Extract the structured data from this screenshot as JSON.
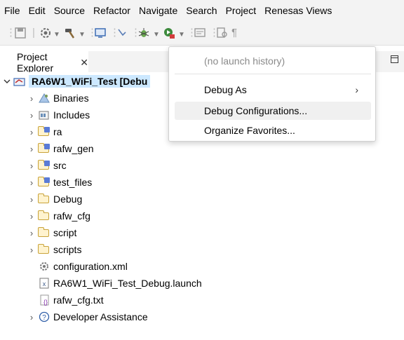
{
  "menubar": {
    "items": [
      "File",
      "Edit",
      "Source",
      "Refactor",
      "Navigate",
      "Search",
      "Project",
      "Renesas Views"
    ]
  },
  "toolbar": {
    "icons": [
      "save-icon",
      "build-icon",
      "hammer-icon",
      "terminal-icon",
      "connect-icon",
      "debug-icon",
      "run-icon",
      "open-type-icon",
      "search-icon",
      "show-whitespace-icon"
    ]
  },
  "view": {
    "tab_label": "Project Explorer",
    "close_glyph": "✕"
  },
  "tree": {
    "root": "RA6W1_WiFi_Test [Debu",
    "items": [
      {
        "label": "Binaries",
        "icon": "binaries-icon"
      },
      {
        "label": "Includes",
        "icon": "includes-icon"
      },
      {
        "label": "ra",
        "icon": "source-folder-icon"
      },
      {
        "label": "rafw_gen",
        "icon": "source-folder-icon"
      },
      {
        "label": "src",
        "icon": "source-folder-icon"
      },
      {
        "label": "test_files",
        "icon": "source-folder-icon"
      },
      {
        "label": "Debug",
        "icon": "folder-icon"
      },
      {
        "label": "rafw_cfg",
        "icon": "folder-icon"
      },
      {
        "label": "script",
        "icon": "folder-icon"
      },
      {
        "label": "scripts",
        "icon": "folder-icon"
      },
      {
        "label": "configuration.xml",
        "icon": "config-file-icon"
      },
      {
        "label": "RA6W1_WiFi_Test_Debug.launch",
        "icon": "launch-file-icon"
      },
      {
        "label": "rafw_cfg.txt",
        "icon": "text-file-icon"
      },
      {
        "label": "Developer Assistance",
        "icon": "help-icon"
      }
    ]
  },
  "popup": {
    "no_history": "(no launch history)",
    "debug_as": "Debug As",
    "debug_configurations": "Debug Configurations...",
    "organize_favorites": "Organize Favorites..."
  },
  "colors": {
    "selection": "#cce8ff",
    "hover": "#f0f0f0",
    "folder": "#c9a33a"
  }
}
